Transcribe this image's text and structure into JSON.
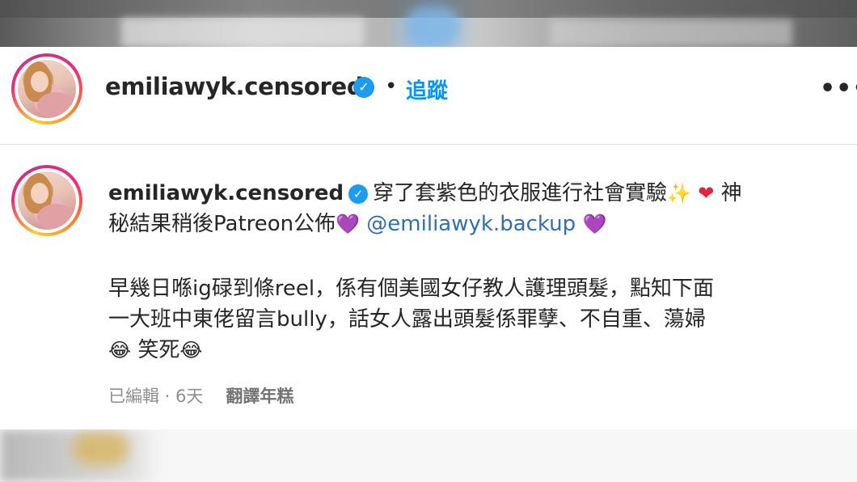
{
  "post": {
    "username": "emiliawyk.censored",
    "verified_icon": "verified-badge-icon",
    "dot": "•",
    "follow_label": "追蹤",
    "more_label": "•••"
  },
  "comment": {
    "username": "emiliawyk.censored",
    "text_1": "穿了套紫色的衣服進行社會實驗",
    "emoji_sparkle": "✨",
    "emoji_red_heart": "❤",
    "text_2": "神",
    "text_3": "秘結果稍後Patreon公佈",
    "emoji_purple_heart": "💜",
    "mention": "@emiliawyk.backup",
    "paragraph_line1": "早幾日喺ig碌到條reel，係有個美國女仔教人護理頭髮，點知下面",
    "paragraph_line2": "一大班中東佬留言bully，話女人露出頭髮係罪孽、不自重、蕩婦",
    "emoji_laugh": "😂",
    "paragraph_line3": "笑死",
    "edited_label": "已編輯",
    "time_label": "6天",
    "translate_label": "翻譯年糕"
  },
  "colors": {
    "follow_blue": "#0095f6",
    "verified_blue": "#1d9bf0",
    "mention_blue": "#2f6fb3",
    "meta_gray": "#8e8e8e"
  }
}
